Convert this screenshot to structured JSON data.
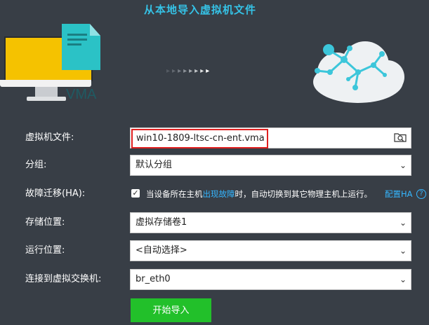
{
  "page": {
    "title": "从本地导入虚拟机文件"
  },
  "illustration": {
    "file_label": "VMA",
    "arrows": [
      "▸",
      "▸",
      "▸",
      "▸",
      "▸",
      "▸",
      "▸",
      "▸"
    ],
    "colors": {
      "screen": "#f5c200",
      "file": "#2bc2c6",
      "cloud": "#eef1f3",
      "node": "#3cc6da"
    }
  },
  "form": {
    "vm_file": {
      "label": "虚拟机文件:",
      "value": "win10-1809-ltsc-cn-ent.vma",
      "icon": "folder-search-icon"
    },
    "group": {
      "label": "分组:",
      "value": "默认分组"
    },
    "ha": {
      "label": "故障迁移(HA):",
      "checked": true,
      "text_before": "当设备所在主机",
      "text_link": "出现故障",
      "text_after": "时，自动切换到其它物理主机上运行。",
      "config_link": "配置HA",
      "help_symbol": "?"
    },
    "storage": {
      "label": "存储位置:",
      "value": "虚拟存储卷1"
    },
    "run_location": {
      "label": "运行位置:",
      "value": "<自动选择>"
    },
    "vswitch": {
      "label": "连接到虚拟交换机:",
      "value": "br_eth0"
    },
    "dropdown_symbol": "⌄",
    "start_button": "开始导入"
  }
}
